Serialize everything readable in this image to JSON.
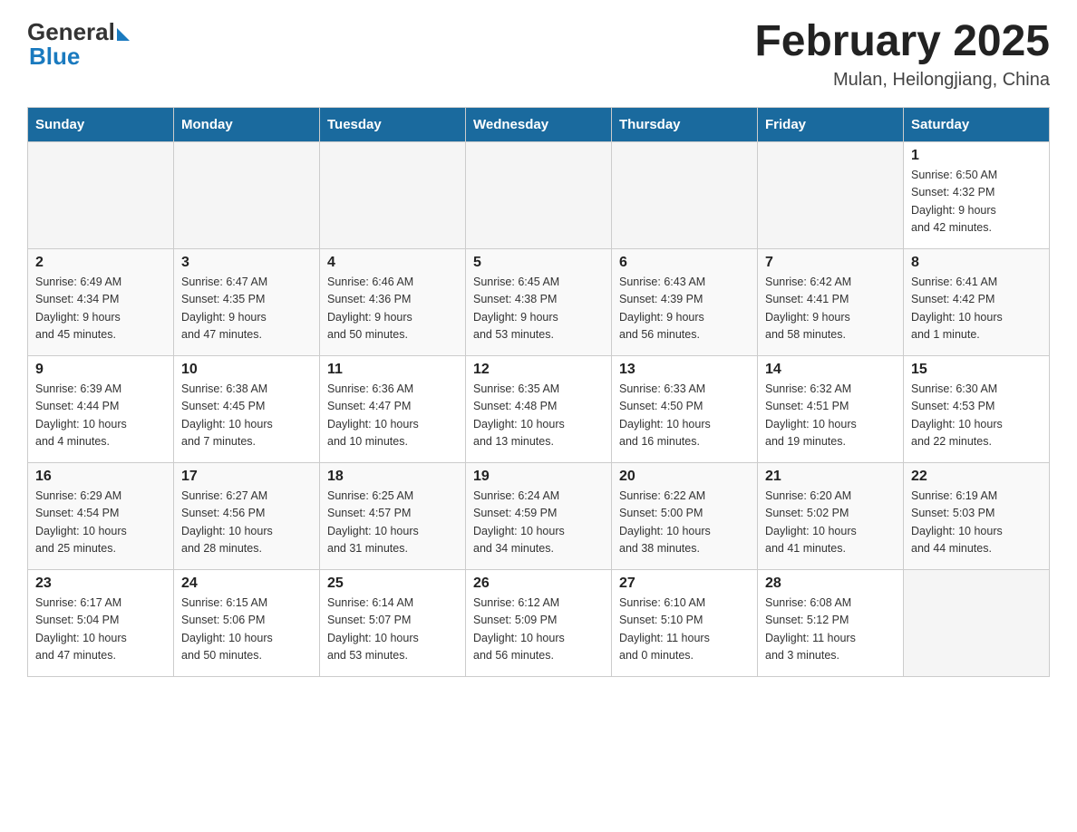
{
  "logo": {
    "general": "General",
    "blue": "Blue"
  },
  "header": {
    "month": "February 2025",
    "location": "Mulan, Heilongjiang, China"
  },
  "weekdays": [
    "Sunday",
    "Monday",
    "Tuesday",
    "Wednesday",
    "Thursday",
    "Friday",
    "Saturday"
  ],
  "weeks": [
    [
      {
        "day": "",
        "info": ""
      },
      {
        "day": "",
        "info": ""
      },
      {
        "day": "",
        "info": ""
      },
      {
        "day": "",
        "info": ""
      },
      {
        "day": "",
        "info": ""
      },
      {
        "day": "",
        "info": ""
      },
      {
        "day": "1",
        "info": "Sunrise: 6:50 AM\nSunset: 4:32 PM\nDaylight: 9 hours\nand 42 minutes."
      }
    ],
    [
      {
        "day": "2",
        "info": "Sunrise: 6:49 AM\nSunset: 4:34 PM\nDaylight: 9 hours\nand 45 minutes."
      },
      {
        "day": "3",
        "info": "Sunrise: 6:47 AM\nSunset: 4:35 PM\nDaylight: 9 hours\nand 47 minutes."
      },
      {
        "day": "4",
        "info": "Sunrise: 6:46 AM\nSunset: 4:36 PM\nDaylight: 9 hours\nand 50 minutes."
      },
      {
        "day": "5",
        "info": "Sunrise: 6:45 AM\nSunset: 4:38 PM\nDaylight: 9 hours\nand 53 minutes."
      },
      {
        "day": "6",
        "info": "Sunrise: 6:43 AM\nSunset: 4:39 PM\nDaylight: 9 hours\nand 56 minutes."
      },
      {
        "day": "7",
        "info": "Sunrise: 6:42 AM\nSunset: 4:41 PM\nDaylight: 9 hours\nand 58 minutes."
      },
      {
        "day": "8",
        "info": "Sunrise: 6:41 AM\nSunset: 4:42 PM\nDaylight: 10 hours\nand 1 minute."
      }
    ],
    [
      {
        "day": "9",
        "info": "Sunrise: 6:39 AM\nSunset: 4:44 PM\nDaylight: 10 hours\nand 4 minutes."
      },
      {
        "day": "10",
        "info": "Sunrise: 6:38 AM\nSunset: 4:45 PM\nDaylight: 10 hours\nand 7 minutes."
      },
      {
        "day": "11",
        "info": "Sunrise: 6:36 AM\nSunset: 4:47 PM\nDaylight: 10 hours\nand 10 minutes."
      },
      {
        "day": "12",
        "info": "Sunrise: 6:35 AM\nSunset: 4:48 PM\nDaylight: 10 hours\nand 13 minutes."
      },
      {
        "day": "13",
        "info": "Sunrise: 6:33 AM\nSunset: 4:50 PM\nDaylight: 10 hours\nand 16 minutes."
      },
      {
        "day": "14",
        "info": "Sunrise: 6:32 AM\nSunset: 4:51 PM\nDaylight: 10 hours\nand 19 minutes."
      },
      {
        "day": "15",
        "info": "Sunrise: 6:30 AM\nSunset: 4:53 PM\nDaylight: 10 hours\nand 22 minutes."
      }
    ],
    [
      {
        "day": "16",
        "info": "Sunrise: 6:29 AM\nSunset: 4:54 PM\nDaylight: 10 hours\nand 25 minutes."
      },
      {
        "day": "17",
        "info": "Sunrise: 6:27 AM\nSunset: 4:56 PM\nDaylight: 10 hours\nand 28 minutes."
      },
      {
        "day": "18",
        "info": "Sunrise: 6:25 AM\nSunset: 4:57 PM\nDaylight: 10 hours\nand 31 minutes."
      },
      {
        "day": "19",
        "info": "Sunrise: 6:24 AM\nSunset: 4:59 PM\nDaylight: 10 hours\nand 34 minutes."
      },
      {
        "day": "20",
        "info": "Sunrise: 6:22 AM\nSunset: 5:00 PM\nDaylight: 10 hours\nand 38 minutes."
      },
      {
        "day": "21",
        "info": "Sunrise: 6:20 AM\nSunset: 5:02 PM\nDaylight: 10 hours\nand 41 minutes."
      },
      {
        "day": "22",
        "info": "Sunrise: 6:19 AM\nSunset: 5:03 PM\nDaylight: 10 hours\nand 44 minutes."
      }
    ],
    [
      {
        "day": "23",
        "info": "Sunrise: 6:17 AM\nSunset: 5:04 PM\nDaylight: 10 hours\nand 47 minutes."
      },
      {
        "day": "24",
        "info": "Sunrise: 6:15 AM\nSunset: 5:06 PM\nDaylight: 10 hours\nand 50 minutes."
      },
      {
        "day": "25",
        "info": "Sunrise: 6:14 AM\nSunset: 5:07 PM\nDaylight: 10 hours\nand 53 minutes."
      },
      {
        "day": "26",
        "info": "Sunrise: 6:12 AM\nSunset: 5:09 PM\nDaylight: 10 hours\nand 56 minutes."
      },
      {
        "day": "27",
        "info": "Sunrise: 6:10 AM\nSunset: 5:10 PM\nDaylight: 11 hours\nand 0 minutes."
      },
      {
        "day": "28",
        "info": "Sunrise: 6:08 AM\nSunset: 5:12 PM\nDaylight: 11 hours\nand 3 minutes."
      },
      {
        "day": "",
        "info": ""
      }
    ]
  ]
}
